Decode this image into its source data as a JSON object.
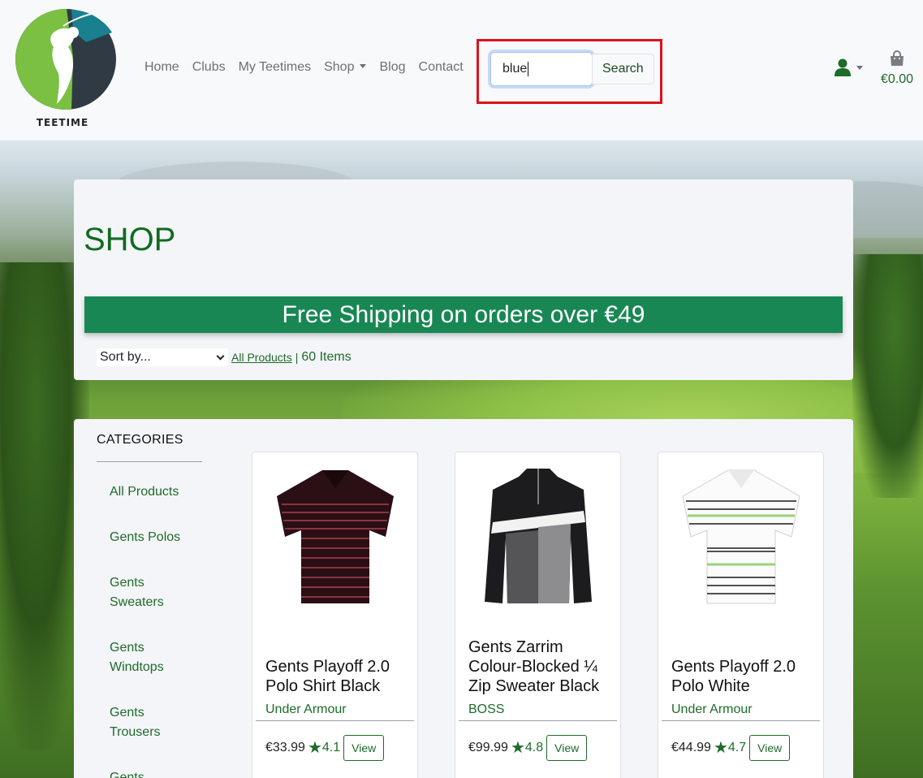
{
  "brand": {
    "logo_text": "TEETIME"
  },
  "nav": {
    "items": [
      {
        "label": "Home"
      },
      {
        "label": "Clubs"
      },
      {
        "label": "My Teetimes"
      },
      {
        "label": "Shop",
        "dropdown": true
      },
      {
        "label": "Blog"
      },
      {
        "label": "Contact"
      }
    ]
  },
  "search": {
    "value": "blue",
    "button_label": "Search"
  },
  "cart": {
    "total": "€0.00"
  },
  "shop": {
    "title": "SHOP",
    "banner": "Free Shipping on orders over €49",
    "sort_label": "Sort by...",
    "crumb_all": "All Products",
    "crumb_sep": "|",
    "item_count": "60 Items"
  },
  "categories": {
    "heading": "CATEGORIES",
    "items": [
      "All Products",
      "Gents Polos",
      "Gents Sweaters",
      "Gents Windtops",
      "Gents Trousers",
      "Gents"
    ]
  },
  "products": [
    {
      "name": "Gents Playoff 2.0 Polo Shirt Black",
      "brand": "Under Armour",
      "price": "€33.99",
      "rating": "4.1",
      "view_label": "View"
    },
    {
      "name": "Gents Zarrim Colour-Blocked ¼ Zip Sweater Black",
      "brand": "BOSS",
      "price": "€99.99",
      "rating": "4.8",
      "view_label": "View"
    },
    {
      "name": "Gents Playoff 2.0 Polo White",
      "brand": "Under Armour",
      "price": "€44.99",
      "rating": "4.7",
      "view_label": "View"
    }
  ],
  "colors": {
    "accent_green": "#1e6b2a",
    "banner_green": "#198754",
    "highlight_red": "#e0111d"
  }
}
